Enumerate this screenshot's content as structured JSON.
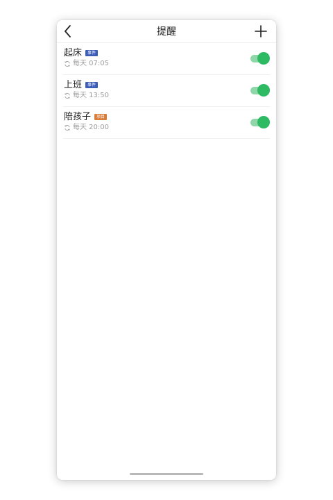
{
  "header": {
    "title": "提醒",
    "back_icon": "chevron-left-icon",
    "add_icon": "plus-icon"
  },
  "reminders": [
    {
      "title": "起床",
      "badge": "事件",
      "badge_color": "#3b5cb8",
      "repeat_icon": "repeat-icon",
      "schedule": "每天 07:05",
      "enabled": true
    },
    {
      "title": "上班",
      "badge": "事件",
      "badge_color": "#3b5cb8",
      "repeat_icon": "repeat-icon",
      "schedule": "每天 13:50",
      "enabled": true
    },
    {
      "title": "陪孩子",
      "badge": "项目",
      "badge_color": "#d97d3a",
      "repeat_icon": "repeat-icon",
      "schedule": "每天 20:00",
      "enabled": true
    }
  ],
  "colors": {
    "toggle_on": "#2dba63",
    "toggle_track_on": "#8fd7a8"
  }
}
